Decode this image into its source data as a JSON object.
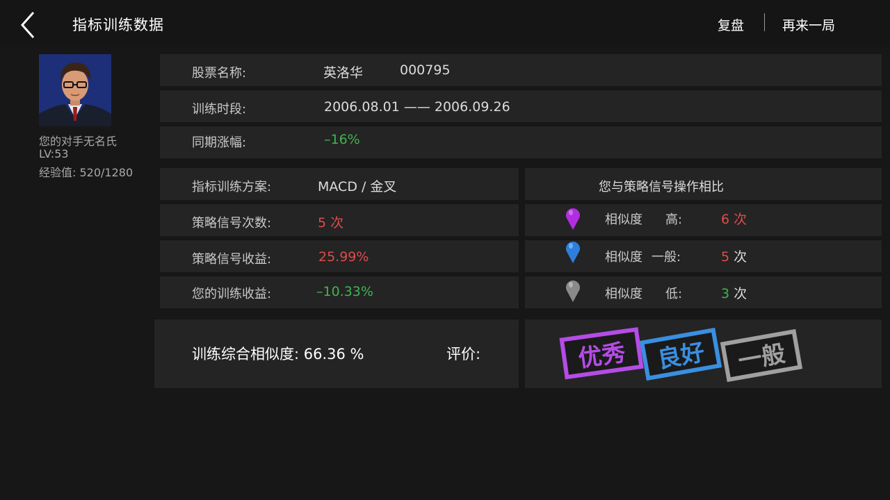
{
  "header": {
    "title": "指标训练数据",
    "replay_label": "复盘",
    "again_label": "再来一局"
  },
  "player": {
    "opponent_name": "您的对手无名氏",
    "level": "LV:53",
    "exp_label": "经验值:",
    "exp_value": "520/1280"
  },
  "stock": {
    "name_label": "股票名称:",
    "name": "英洛华",
    "code": "000795",
    "period_label": "训练时段:",
    "period": "2006.08.01 —— 2006.09.26",
    "change_label": "同期涨幅:",
    "change": "–16%"
  },
  "strategy": {
    "plan_label": "指标训练方案:",
    "plan": "MACD / 金叉",
    "signal_count_label": "策略信号次数:",
    "signal_count": "5 次",
    "signal_return_label": "策略信号收益:",
    "signal_return": "25.99%",
    "your_return_label": "您的训练收益:",
    "your_return": "–10.33%"
  },
  "comparison": {
    "title": "您与策略信号操作相比",
    "rows": [
      {
        "label": "相似度",
        "level": "高:",
        "count": "6",
        "unit": "次",
        "count_color": "#e14b4b",
        "pin_color": "#b02ee0"
      },
      {
        "label": "相似度",
        "level": "一般:",
        "count": "5",
        "unit": "次",
        "count_color": "#e14b4b",
        "pin_color": "#2e7fdc"
      },
      {
        "label": "相似度",
        "level": "低:",
        "count": "3",
        "unit": "次",
        "count_color": "#3fb54f",
        "pin_color": "#8a8a8a"
      }
    ]
  },
  "summary": {
    "similarity_label": "训练综合相似度:",
    "similarity_value": "66.36 %",
    "rating_label": "评价:"
  },
  "ratings": [
    {
      "text": "优秀",
      "color": "#b54ce6"
    },
    {
      "text": "良好",
      "color": "#3a8fe0"
    },
    {
      "text": "一般",
      "color": "#a0a0a0"
    }
  ]
}
